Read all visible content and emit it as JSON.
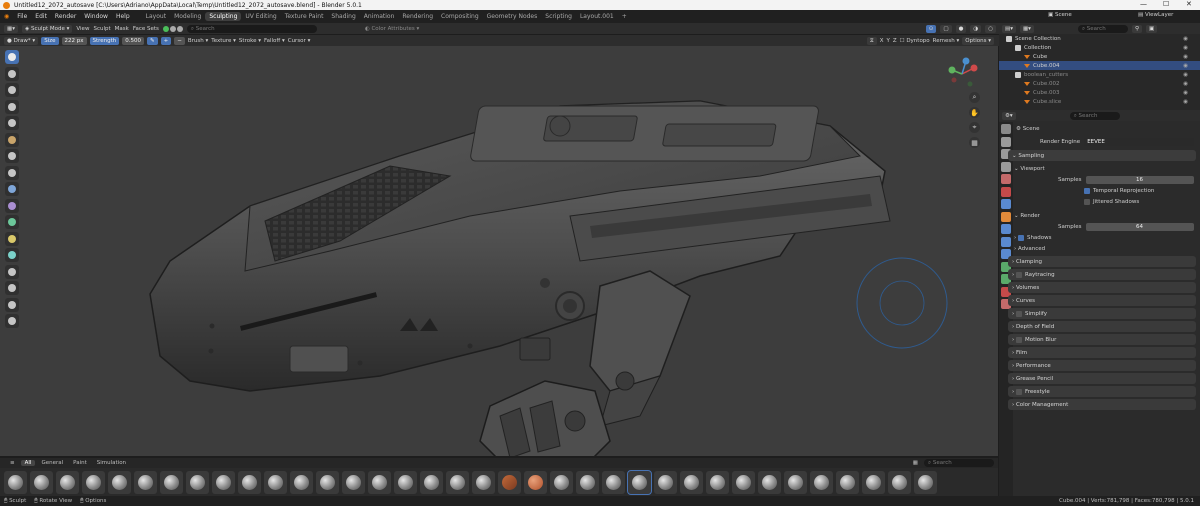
{
  "window": {
    "title": "Untitled12_2072_autosave [C:\\Users\\Adriano\\AppData\\Local\\Temp\\Untitled12_2072_autosave.blend] - Blender 5.0.1"
  },
  "menu": {
    "items": [
      "File",
      "Edit",
      "Render",
      "Window",
      "Help"
    ],
    "workspaces": [
      "Layout",
      "Modeling",
      "Sculpting",
      "UV Editing",
      "Texture Paint",
      "Shading",
      "Animation",
      "Rendering",
      "Compositing",
      "Geometry Nodes",
      "Scripting",
      "Layout.001"
    ],
    "active_workspace": "Sculpting",
    "scene_label": "Scene",
    "view_layer_label": "ViewLayer"
  },
  "header": {
    "mode": "Sculpt Mode",
    "menus": [
      "View",
      "Sculpt",
      "Mask",
      "Face Sets"
    ],
    "search_placeholder": "Search",
    "color_attributes": "Color Attributes"
  },
  "tool_header": {
    "brush": "Draw*",
    "size_label": "Size",
    "size_value": "222 px",
    "strength_label": "Strength",
    "strength_value": "0.500",
    "menus": [
      "Brush",
      "Texture",
      "Stroke",
      "Falloff",
      "Cursor"
    ],
    "dyntopo": "Dyntopo",
    "remesh": "Remesh",
    "options": "Options"
  },
  "colors": {
    "accent": "#4772b3",
    "brand": "#e87d0d",
    "viewport_bg": "#3d3d3d",
    "brush_circle": "#2f5b8f"
  },
  "toolbar_icons": [
    "draw-icon",
    "draw-sharp-icon",
    "clay-icon",
    "clay-strips-icon",
    "layer-icon",
    "inflate-icon",
    "blob-icon",
    "crease-icon",
    "smooth-icon",
    "flatten-icon",
    "fill-icon",
    "scrape-icon",
    "pinch-icon",
    "grab-icon",
    "snake-hook-icon",
    "thumb-icon",
    "pose-icon"
  ],
  "shelf": {
    "tabs": [
      "All",
      "General",
      "Paint",
      "Simulation"
    ],
    "active_tab": "All",
    "search_placeholder": "Search",
    "brush_count": 36,
    "selected_index": 24
  },
  "status": {
    "left": [
      "Sculpt",
      "Rotate View",
      "Options"
    ],
    "right": "Cube.004 | Verts:781,798 | Faces:780,798 | 5.0.1"
  },
  "outliner": {
    "search_placeholder": "Search",
    "rows": [
      {
        "label": "Scene Collection",
        "depth": 0,
        "state": "normal"
      },
      {
        "label": "Collection",
        "depth": 1,
        "state": "normal"
      },
      {
        "label": "Cube",
        "depth": 2,
        "state": "normal"
      },
      {
        "label": "Cube.004",
        "depth": 2,
        "state": "selected"
      },
      {
        "label": "boolean_cutters",
        "depth": 1,
        "state": "dim"
      },
      {
        "label": "Cube.002",
        "depth": 2,
        "state": "dim"
      },
      {
        "label": "Cube.003",
        "depth": 2,
        "state": "dim"
      },
      {
        "label": "Cube.slice",
        "depth": 2,
        "state": "dim"
      }
    ]
  },
  "properties": {
    "search_placeholder": "Search",
    "context": "Scene",
    "render_engine_label": "Render Engine",
    "render_engine": "EEVEE",
    "sampling": "Sampling",
    "viewport": "Viewport",
    "samples_label": "Samples",
    "viewport_samples": "16",
    "temporal_reprojection": "Temporal Reprojection",
    "jittered_shadows": "Jittered Shadows",
    "render": "Render",
    "render_samples": "64",
    "shadows": "Shadows",
    "advanced": "Advanced",
    "panels": [
      "Clamping",
      "Raytracing",
      "Volumes",
      "Curves",
      "Simplify",
      "Depth of Field",
      "Motion Blur",
      "Film",
      "Performance",
      "Grease Pencil",
      "Freestyle",
      "Color Management"
    ]
  }
}
